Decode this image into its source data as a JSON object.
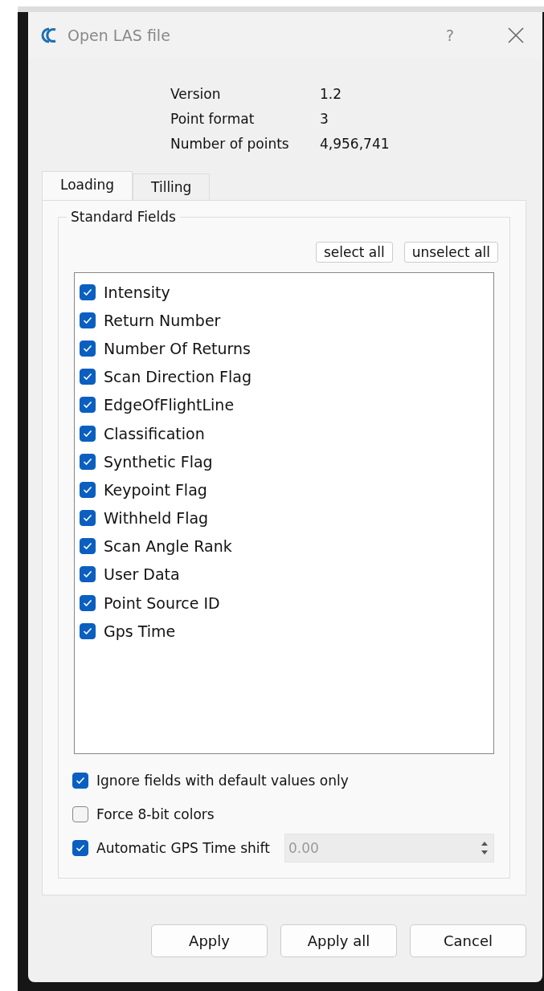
{
  "window": {
    "title": "Open LAS file",
    "help": "?"
  },
  "info": [
    {
      "label": "Version",
      "value": "1.2"
    },
    {
      "label": "Point format",
      "value": "3"
    },
    {
      "label": "Number of points",
      "value": "4,956,741"
    }
  ],
  "tabs": [
    {
      "label": "Loading",
      "selected": true
    },
    {
      "label": "Tilling",
      "selected": false
    }
  ],
  "group": {
    "title": "Standard Fields",
    "select_all": "select all",
    "unselect_all": "unselect all"
  },
  "fields": [
    {
      "label": "Intensity",
      "checked": true
    },
    {
      "label": "Return Number",
      "checked": true
    },
    {
      "label": "Number Of Returns",
      "checked": true
    },
    {
      "label": "Scan Direction Flag",
      "checked": true
    },
    {
      "label": "EdgeOfFlightLine",
      "checked": true
    },
    {
      "label": "Classification",
      "checked": true
    },
    {
      "label": "Synthetic Flag",
      "checked": true
    },
    {
      "label": "Keypoint Flag",
      "checked": true
    },
    {
      "label": "Withheld Flag",
      "checked": true
    },
    {
      "label": "Scan Angle Rank",
      "checked": true
    },
    {
      "label": "User Data",
      "checked": true
    },
    {
      "label": "Point Source ID",
      "checked": true
    },
    {
      "label": "Gps Time",
      "checked": true
    }
  ],
  "options": [
    {
      "kind": "checkbox",
      "label": "Ignore fields with default values only",
      "checked": true
    },
    {
      "kind": "checkbox",
      "label": "Force 8-bit colors",
      "checked": false
    },
    {
      "kind": "spin",
      "label": "Automatic GPS Time shift",
      "checked": true,
      "value": "0.00",
      "disabled": true
    }
  ],
  "buttons": [
    "Apply",
    "Apply all",
    "Cancel"
  ]
}
